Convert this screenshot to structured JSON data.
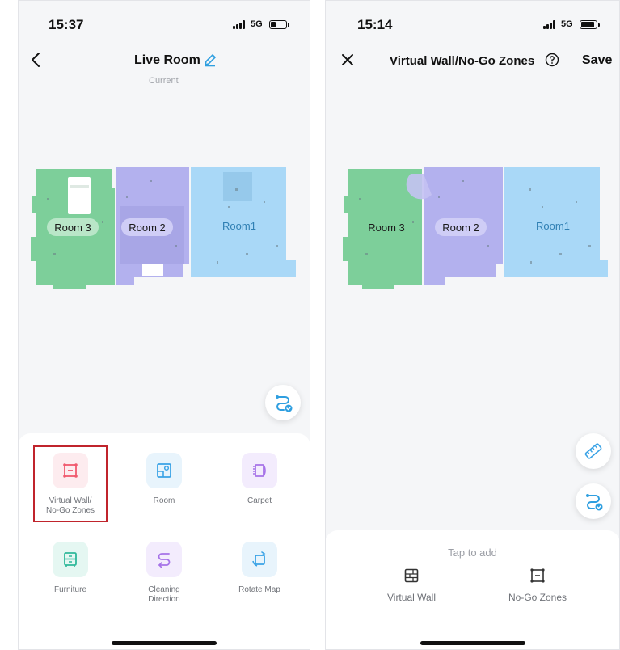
{
  "left_screen": {
    "status": {
      "time": "15:37",
      "network": "5G"
    },
    "nav": {
      "title": "Live Room",
      "subtitle": "Current"
    },
    "rooms": [
      "Room 3",
      "Room 2",
      "Room1"
    ],
    "tools": [
      {
        "id": "virtual-wall-no-go",
        "label": "Virtual Wall/\nNo-Go Zones",
        "icon": "no-go-zone-icon",
        "color": "#f05a6e",
        "bg": "#fdecef",
        "selected": true
      },
      {
        "id": "room",
        "label": "Room",
        "icon": "room-map-icon",
        "color": "#3ba3e6",
        "bg": "#e8f4fc",
        "selected": false
      },
      {
        "id": "carpet",
        "label": "Carpet",
        "icon": "carpet-icon",
        "color": "#a673e8",
        "bg": "#f3ecfd",
        "selected": false
      },
      {
        "id": "furniture",
        "label": "Furniture",
        "icon": "furniture-icon",
        "color": "#2fb89a",
        "bg": "#e5f7f2",
        "selected": false
      },
      {
        "id": "cleaning-direction",
        "label": "Cleaning\nDirection",
        "icon": "cleaning-direction-icon",
        "color": "#a673e8",
        "bg": "#f3ecfd",
        "selected": false
      },
      {
        "id": "rotate-map",
        "label": "Rotate Map",
        "icon": "rotate-map-icon",
        "color": "#3ba3e6",
        "bg": "#e8f4fc",
        "selected": false
      }
    ]
  },
  "right_screen": {
    "status": {
      "time": "15:14",
      "network": "5G"
    },
    "nav": {
      "title": "Virtual Wall/No-Go Zones",
      "save": "Save"
    },
    "rooms": [
      "Room 3",
      "Room 2",
      "Room1"
    ],
    "sheet": {
      "hint": "Tap to add",
      "items": [
        {
          "label": "Virtual Wall",
          "icon": "virtual-wall-icon"
        },
        {
          "label": "No-Go Zones",
          "icon": "no-go-zone-icon"
        }
      ]
    }
  },
  "colors": {
    "room3": "#7dcf9a",
    "room2": "#b3b1ee",
    "room1": "#a9d8f7",
    "accent": "#2f9fe0",
    "highlight": "#c0242c"
  }
}
